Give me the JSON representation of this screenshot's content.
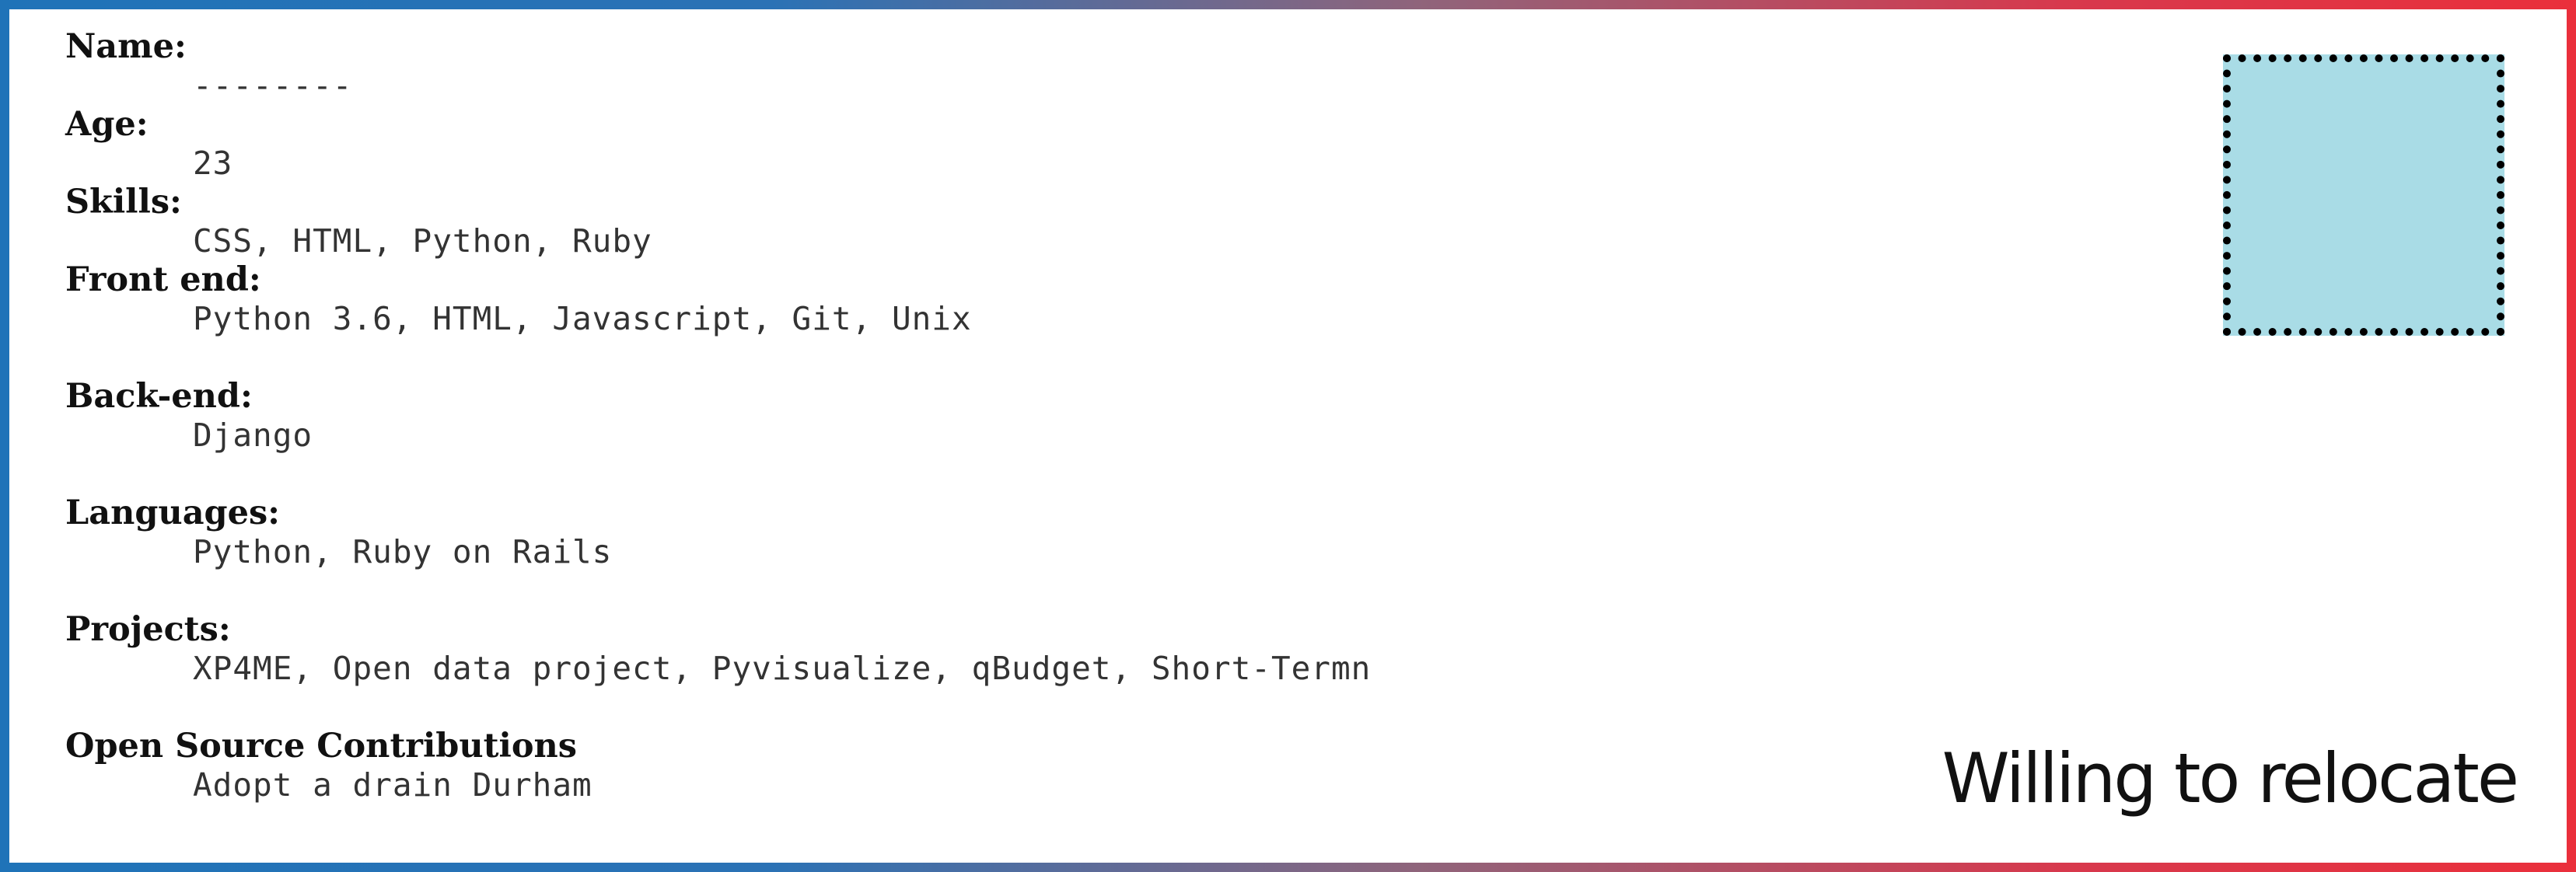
{
  "profile": {
    "name_label": "Name:",
    "name_value": "--------",
    "age_label": "Age:",
    "age_value": "23",
    "skills_label": "Skills:",
    "skills_value": "CSS, HTML, Python, Ruby",
    "front_end_label": "Front end:",
    "front_end_value": "Python 3.6, HTML, Javascript, Git, Unix",
    "back_end_label": "Back-end:",
    "back_end_value": "Django",
    "languages_label": "Languages:",
    "languages_value": "Python, Ruby on Rails",
    "projects_label": "Projects:",
    "projects_value": "XP4ME, Open data project, Pyvisualize, qBudget, Short-Termn",
    "open_source_label": "Open Source Contributions",
    "open_source_value": "Adopt a drain Durham"
  },
  "photo": {
    "fill_color": "#a9dce6",
    "border_color": "#000000"
  },
  "footer": {
    "relocate_text": "Willing to relocate"
  },
  "colors": {
    "border_left": "#1f73b8",
    "border_right": "#ea2f3b"
  }
}
